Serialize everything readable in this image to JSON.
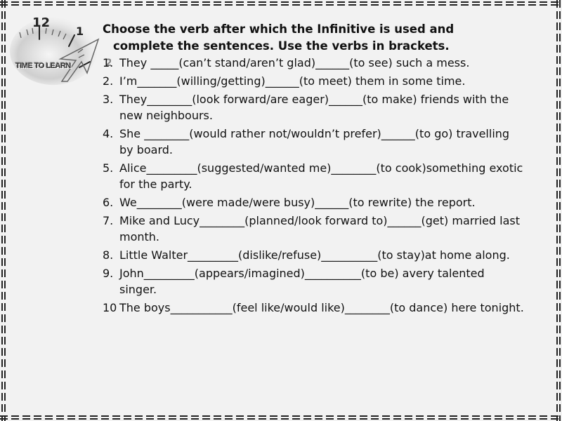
{
  "logo": {
    "label": "TIME TO LEARN",
    "numerals": [
      "12",
      "1",
      "2"
    ],
    "icon": "clock-icon"
  },
  "instructions": {
    "line1": "Choose the verb after which the Infinitive is used and",
    "line2": "complete the sentences. Use the verbs in brackets."
  },
  "exercises": [
    {
      "num": "1.",
      "text": "They _____(can’t stand/aren’t glad)______(to see) such a mess."
    },
    {
      "num": "2.",
      "text": "I’m_______(willing/getting)______(to meet) them in some time."
    },
    {
      "num": "3.",
      "text": "They________(look forward/are eager)______(to make) friends with the new neighbours."
    },
    {
      "num": "4.",
      "text": "She ________(would rather not/wouldn’t prefer)______(to go) travelling by board."
    },
    {
      "num": "5.",
      "text": "Alice_________(suggested/wanted me)________(to cook)something exotic for the party."
    },
    {
      "num": "6.",
      "text": "We________(were made/were busy)______(to rewrite) the report."
    },
    {
      "num": "7.",
      "text": "Mike and Lucy________(planned/look forward to)______(get) married last month."
    },
    {
      "num": "8.",
      "text": "Little Walter_________(dislike/refuse)__________(to stay)at home along."
    },
    {
      "num": "9.",
      "text": "John_________(appears/imagined)__________(to be) avery talented singer."
    },
    {
      "num": "10",
      "text": "The boys___________(feel like/would like)________(to dance) here tonight."
    }
  ]
}
